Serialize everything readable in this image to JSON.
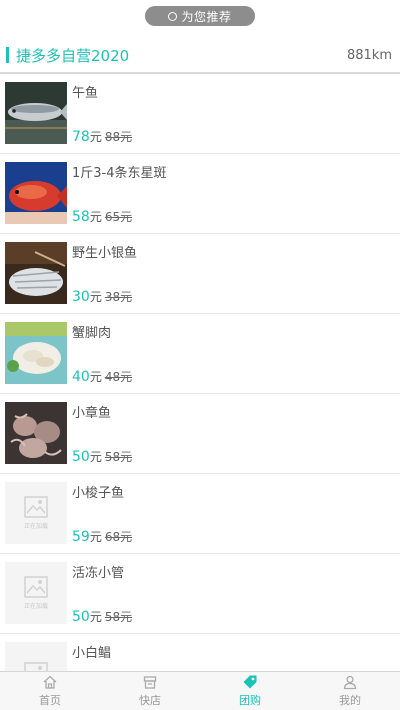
{
  "top_pill": {
    "label": "为您推荐"
  },
  "header": {
    "title": "捷多多自营2020",
    "distance": "881km"
  },
  "items": [
    {
      "name": "午鱼",
      "price": "78",
      "unit": "元",
      "old_price": "88元",
      "image": "fish-photo"
    },
    {
      "name": "1斤3-4条东星斑",
      "price": "58",
      "unit": "元",
      "old_price": "65元",
      "image": "red-grouper-photo"
    },
    {
      "name": "野生小银鱼",
      "price": "30",
      "unit": "元",
      "old_price": "38元",
      "image": "silverfish-photo"
    },
    {
      "name": "蟹脚肉",
      "price": "40",
      "unit": "元",
      "old_price": "48元",
      "image": "crab-meat-photo"
    },
    {
      "name": "小章鱼",
      "price": "50",
      "unit": "元",
      "old_price": "58元",
      "image": "octopus-photo"
    },
    {
      "name": "小梭子鱼",
      "price": "59",
      "unit": "元",
      "old_price": "68元",
      "image": "placeholder"
    },
    {
      "name": "活冻小管",
      "price": "50",
      "unit": "元",
      "old_price": "58元",
      "image": "placeholder"
    },
    {
      "name": "小白鲳",
      "price": "",
      "unit": "",
      "old_price": "",
      "image": "placeholder"
    }
  ],
  "placeholder_text": "正在加载",
  "tabbar": {
    "tabs": [
      {
        "label": "首页",
        "icon": "home-icon"
      },
      {
        "label": "快店",
        "icon": "shop-icon"
      },
      {
        "label": "团购",
        "icon": "tag-icon",
        "active": true
      },
      {
        "label": "我的",
        "icon": "user-icon"
      }
    ]
  },
  "colors": {
    "accent": "#1cc1b8",
    "text": "#555555"
  }
}
